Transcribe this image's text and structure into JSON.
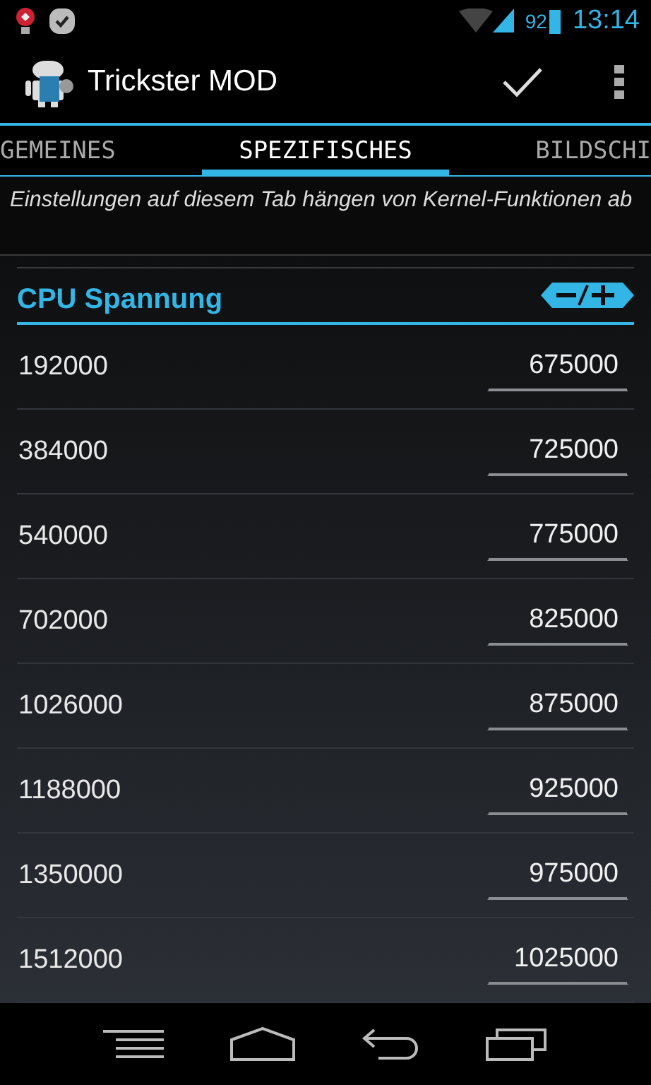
{
  "status_bar": {
    "battery": "92",
    "time": "13:14"
  },
  "action_bar": {
    "title": "Trickster MOD"
  },
  "tabs": [
    {
      "label": "GEMEINES",
      "selected": false
    },
    {
      "label": "SPEZIFISCHES",
      "selected": true
    },
    {
      "label": "BILDSCHI",
      "selected": false
    }
  ],
  "description": "Einstellungen auf diesem Tab hängen von Kernel-Funktionen ab",
  "section": {
    "title": "CPU Spannung"
  },
  "rows": [
    {
      "frequency": "192000",
      "voltage": "675000"
    },
    {
      "frequency": "384000",
      "voltage": "725000"
    },
    {
      "frequency": "540000",
      "voltage": "775000"
    },
    {
      "frequency": "702000",
      "voltage": "825000"
    },
    {
      "frequency": "1026000",
      "voltage": "875000"
    },
    {
      "frequency": "1188000",
      "voltage": "925000"
    },
    {
      "frequency": "1350000",
      "voltage": "975000"
    },
    {
      "frequency": "1512000",
      "voltage": "1025000"
    }
  ]
}
